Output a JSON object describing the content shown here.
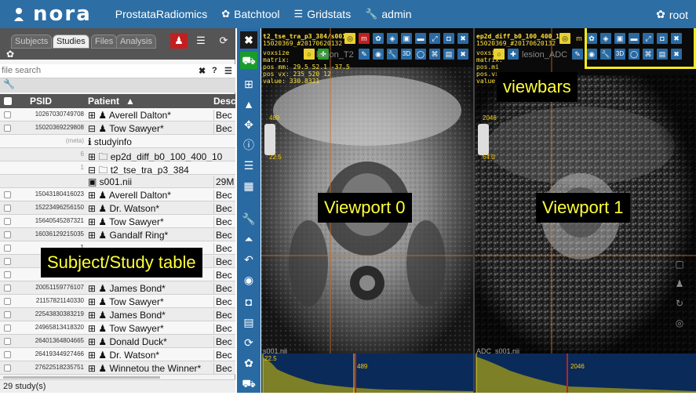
{
  "app": {
    "logo": "nora",
    "nav": [
      {
        "label": "ProstataRadiomics",
        "icon": ""
      },
      {
        "label": "Batchtool",
        "icon": "gear"
      },
      {
        "label": "Gridstats",
        "icon": "list"
      },
      {
        "label": "admin",
        "icon": "wrench"
      }
    ],
    "user": "root"
  },
  "left": {
    "tabs": [
      "Subjects",
      "Studies",
      "Files",
      "Analysis"
    ],
    "active_tab": "Studies",
    "search_placeholder": "file search",
    "search_close": "✖",
    "search_help": "?",
    "columns": [
      "PSID",
      "Patient",
      "Desc"
    ],
    "rows": [
      {
        "psid": "10267030749708",
        "patient": "⊞ ♟ Averell Dalton*",
        "desc": "Bec",
        "cb": true
      },
      {
        "psid": "15020369229808",
        "patient": "⊟ ♟ Tow Sawyer*",
        "desc": "Bec",
        "cb": true
      },
      {
        "psid": "(meta)",
        "patient": "  ℹ studyinfo",
        "desc": "",
        "cb": false
      },
      {
        "psid": "6",
        "patient": "    ⊞ 🗀 ep2d_diff_b0_100_400_10",
        "desc": "",
        "cb": false
      },
      {
        "psid": "1",
        "patient": "    ⊟ 🗀 t2_tse_tra_p3_384",
        "desc": "",
        "cb": false
      },
      {
        "psid": "",
        "patient": "      ▣ s001.nii",
        "desc": "29M",
        "cb": false
      },
      {
        "psid": "15043180416023",
        "patient": "⊞ ♟ Averell Dalton*",
        "desc": "Bec",
        "cb": true
      },
      {
        "psid": "15223496256150",
        "patient": "⊞ ♟ Dr. Watson*",
        "desc": "Bec",
        "cb": true
      },
      {
        "psid": "15640545287321",
        "patient": "⊞ ♟ Tow Sawyer*",
        "desc": "Bec",
        "cb": true
      },
      {
        "psid": "16036129215035",
        "patient": "⊞ ♟ Gandalf Ring*",
        "desc": "Bec",
        "cb": true
      },
      {
        "psid": "1",
        "patient": "",
        "desc": "Bec",
        "cb": true
      },
      {
        "psid": "1",
        "patient": "",
        "desc": "Bec",
        "cb": true
      },
      {
        "psid": "",
        "patient": "",
        "desc": "Bec",
        "cb": true
      },
      {
        "psid": "20051159776107",
        "patient": "⊞ ♟ James Bond*",
        "desc": "Bec",
        "cb": true
      },
      {
        "psid": "21157821140330",
        "patient": "⊞ ♟ Tow Sawyer*",
        "desc": "Bec",
        "cb": true
      },
      {
        "psid": "22543830383219",
        "patient": "⊞ ♟ James Bond*",
        "desc": "Bec",
        "cb": true
      },
      {
        "psid": "24965813418320",
        "patient": "⊞ ♟ Tow Sawyer*",
        "desc": "Bec",
        "cb": true
      },
      {
        "psid": "26401364804665",
        "patient": "⊞ ♟ Donald Duck*",
        "desc": "Bec",
        "cb": true
      },
      {
        "psid": "26419344927466",
        "patient": "⊞ ♟ Dr. Watson*",
        "desc": "Bec",
        "cb": true
      },
      {
        "psid": "27622518235751",
        "patient": "⊞ ♟ Winnetou the Winner*",
        "desc": "Bec",
        "cb": true
      }
    ],
    "footer": "29 study(s)",
    "overlay": "Subject/Study table"
  },
  "viewports": [
    {
      "title": "t2_tse_tra_p3_384/s001.",
      "id": "15020369_#20170620132",
      "voxsize": "voxsize",
      "matrix": "matrix:",
      "pos_mm": "pos mm: 29.5  52.1  -37.5",
      "pos_vx": "pos vx:  235  520  12",
      "value": "value: 330.8321",
      "seg": "lesion_T2",
      "wmax": "489",
      "wmin": "22.5",
      "hmin": "22.5",
      "hmax": "489",
      "file": "s001.nii",
      "overlay": "Viewport 0"
    },
    {
      "title": "ep2d_diff_b0_100_400_1",
      "id": "15020369_#20170620132",
      "voxsize": "voxsiz",
      "matrix": "matrix:",
      "pos_mm": "pos.mi",
      "pos_vx": "pos.vx",
      "value": "value:",
      "seg": "lesion_ADC",
      "wmax": "2046",
      "wmin": "64.0",
      "hmin": "",
      "hmax": "2046",
      "file": "ADC_s001.nii",
      "overlay": "Viewport 1"
    }
  ],
  "viewbars_label": "viewbars",
  "colors": {
    "topbar": "#2d6ea4",
    "highlight": "#ffff3a",
    "accent_red": "#c41f1f",
    "accent_green": "#1a9c2a"
  }
}
